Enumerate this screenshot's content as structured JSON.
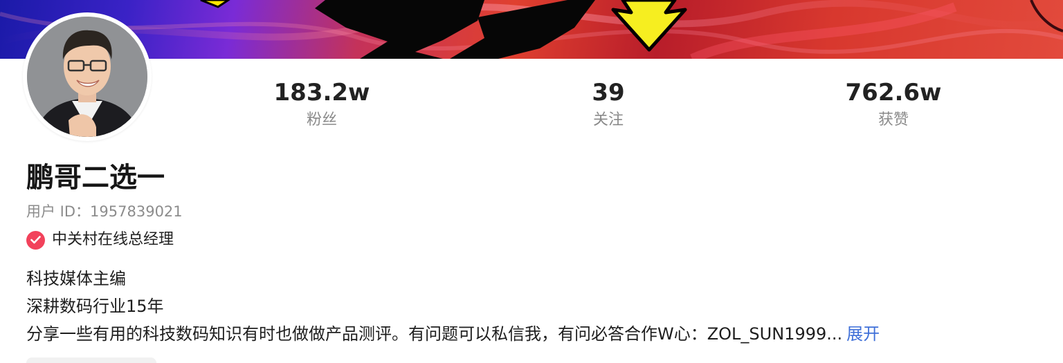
{
  "profile": {
    "name": "鹏哥二选一",
    "user_id_label": "用户 ID：",
    "user_id": "1957839021",
    "verification": "中关村在线总经理"
  },
  "stats": [
    {
      "value": "183.2w",
      "label": "粉丝"
    },
    {
      "value": "39",
      "label": "关注"
    },
    {
      "value": "762.6w",
      "label": "获赞"
    }
  ],
  "bio": {
    "line1": "科技媒体主编",
    "line2": "深耕数码行业15年",
    "line3": "分享一些有用的科技数码知识有时也做做产品测评。有问题可以私信我，有问必答合作W心：ZOL_SUN1999...",
    "expand_label": "展开"
  },
  "icons": {
    "verified": "check-circle-icon",
    "avatar": "avatar-photo"
  },
  "colors": {
    "verified_badge": "#f2425b",
    "expand_link": "#3e6fd8",
    "stat_value": "#222222",
    "muted_text": "#8a8a8a"
  }
}
